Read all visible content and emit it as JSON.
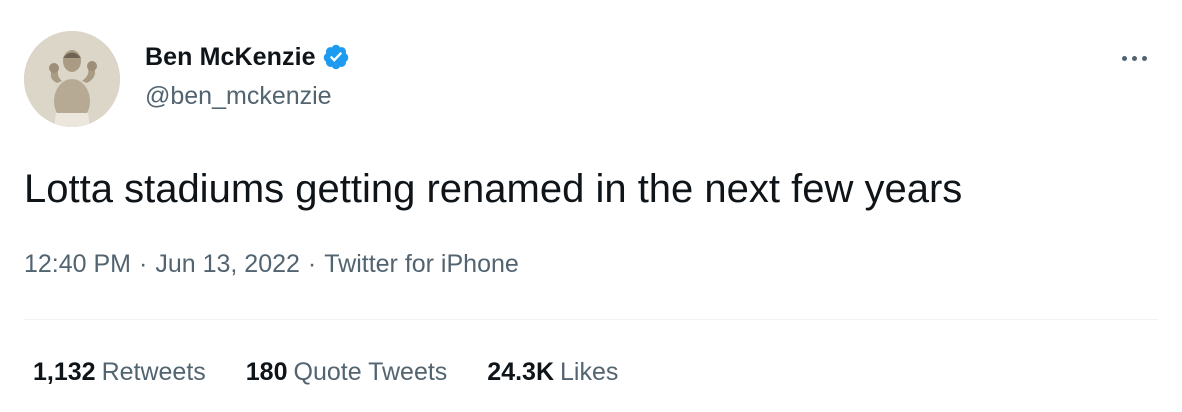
{
  "author": {
    "display_name": "Ben McKenzie",
    "handle": "@ben_mckenzie",
    "verified": true,
    "avatar_icon": "vintage-boxer-photo-avatar"
  },
  "tweet": {
    "text": "Lotta stadiums getting renamed in the next few years",
    "time": "12:40 PM",
    "date": "Jun 13, 2022",
    "source": "Twitter for iPhone",
    "separator": "·"
  },
  "stats": {
    "retweets_count": "1,132",
    "retweets_label": "Retweets",
    "quote_count": "180",
    "quote_label": "Quote Tweets",
    "likes_count": "24.3K",
    "likes_label": "Likes"
  },
  "colors": {
    "text_primary": "#0f1419",
    "text_secondary": "#536471",
    "verified_blue": "#1d9bf0",
    "divider": "#eff3f4"
  },
  "icons": {
    "verified": "verified-badge-icon",
    "more": "more-options-icon"
  }
}
